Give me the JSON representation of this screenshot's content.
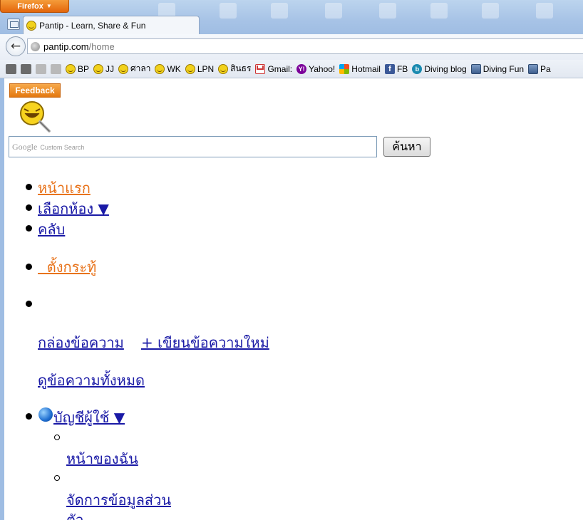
{
  "browser": {
    "app_button_label": "Firefox",
    "tab_title": "Pantip - Learn, Share & Fun",
    "url_host": "pantip.com",
    "url_path": "/home",
    "bookmarks": [
      {
        "label": "BP",
        "icon": "smiley-icon"
      },
      {
        "label": "JJ",
        "icon": "smiley-icon"
      },
      {
        "label": "ศาลา",
        "icon": "smiley-icon"
      },
      {
        "label": "WK",
        "icon": "smiley-icon"
      },
      {
        "label": "LPN",
        "icon": "smiley-icon"
      },
      {
        "label": "สินธร",
        "icon": "smiley-icon"
      },
      {
        "label": "Gmail:",
        "icon": "gmail-icon"
      },
      {
        "label": "Yahoo!",
        "icon": "yahoo-icon"
      },
      {
        "label": "Hotmail",
        "icon": "windows-icon"
      },
      {
        "label": "FB",
        "icon": "facebook-icon"
      },
      {
        "label": "Diving blog",
        "icon": "blog-icon"
      },
      {
        "label": "Diving Fun",
        "icon": "person-icon"
      },
      {
        "label": "Pa",
        "icon": "person-icon"
      }
    ]
  },
  "page": {
    "feedback_label": "Feedback",
    "search": {
      "watermark_brand": "Google",
      "watermark_text": "Custom Search",
      "button_label": "ค้นหา"
    },
    "nav": {
      "home": "หน้าแรก",
      "choose_room": "เลือกห้อง ▼",
      "club": "คลับ",
      "create_topic": "  ตั้งกระทู้",
      "inbox": "กล่องข้อความ",
      "new_message": "+ เขียนข้อความใหม่",
      "all_messages": "ดูข้อความทั้งหมด",
      "account": "บัญชีผู้ใช้ ▼",
      "my_page": "หน้าของฉัน",
      "manage_personal_line1": "จัดการข้อมูลส่วน",
      "manage_personal_line2": "ตัว"
    }
  }
}
